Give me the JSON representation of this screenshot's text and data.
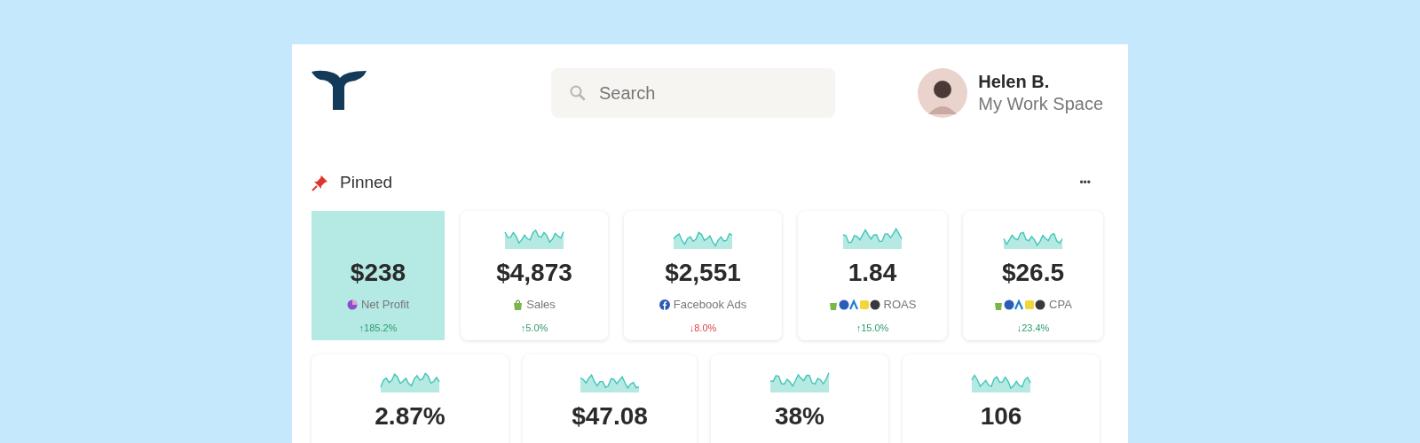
{
  "header": {
    "search": {
      "placeholder": "Search"
    },
    "user": {
      "name": "Helen B.",
      "workspace": "My Work Space"
    }
  },
  "section": {
    "title": "Pinned",
    "menu": "•••"
  },
  "rows": [
    [
      {
        "value": "$238",
        "label": {
          "text": "Net Profit",
          "kind": "profit"
        },
        "change": {
          "text": "↑185.2%",
          "kind": "good"
        },
        "selected": true
      },
      {
        "value": "$4,873",
        "label": {
          "text": "Sales",
          "kind": "shop"
        },
        "change": {
          "text": "↑5.0%",
          "kind": "good"
        },
        "selected": false
      },
      {
        "value": "$2,551",
        "label": {
          "text": "Facebook Ads",
          "kind": "facebook"
        },
        "change": {
          "text": "↓8.0%",
          "kind": "bad"
        },
        "selected": false
      },
      {
        "value": "1.84",
        "label": {
          "text": "ROAS",
          "kind": "multi"
        },
        "change": {
          "text": "↑15.0%",
          "kind": "good"
        },
        "selected": false
      },
      {
        "value": "$26.5",
        "label": {
          "text": "CPA",
          "kind": "multi"
        },
        "change": {
          "text": "↓23.4%",
          "kind": "good"
        },
        "selected": false
      }
    ],
    [
      {
        "value": "2.87%",
        "selected": false
      },
      {
        "value": "$47.08",
        "selected": false
      },
      {
        "value": "38%",
        "selected": false
      },
      {
        "value": "106",
        "selected": false
      }
    ]
  ]
}
